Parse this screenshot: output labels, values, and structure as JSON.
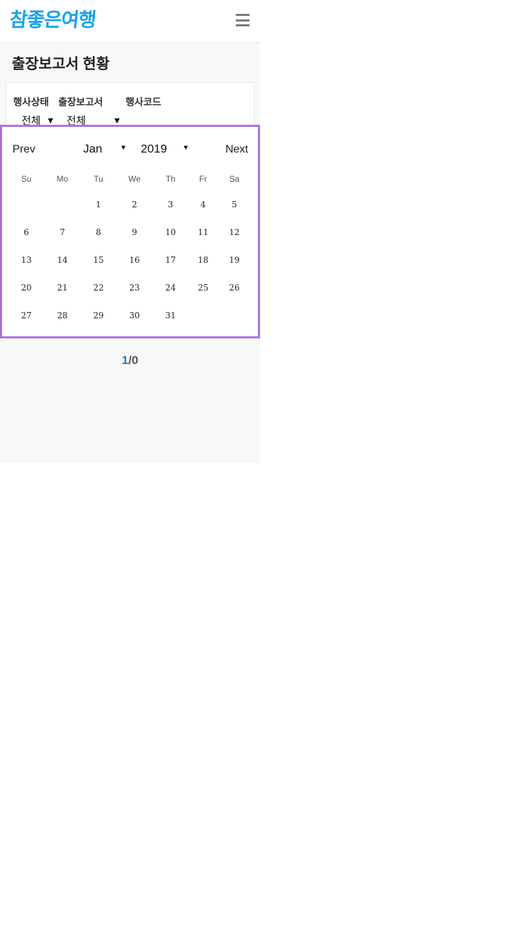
{
  "header": {
    "logo_text": "참좋은여행",
    "menu_icon": "hamburger-menu-icon"
  },
  "page": {
    "title": "출장보고서 현황"
  },
  "filters": {
    "event_status_label": "행사상태",
    "report_label": "출장보고서",
    "event_code_label": "행사코드",
    "event_status_value": "전체",
    "report_value": "전체"
  },
  "calendar": {
    "prev_label": "Prev",
    "next_label": "Next",
    "month_value": "Jan",
    "year_value": "2019",
    "weekdays": [
      "Su",
      "Mo",
      "Tu",
      "We",
      "Th",
      "Fr",
      "Sa"
    ],
    "weeks": [
      [
        "",
        "",
        "1",
        "2",
        "3",
        "4",
        "5"
      ],
      [
        "6",
        "7",
        "8",
        "9",
        "10",
        "11",
        "12"
      ],
      [
        "13",
        "14",
        "15",
        "16",
        "17",
        "18",
        "19"
      ],
      [
        "20",
        "21",
        "22",
        "23",
        "24",
        "25",
        "26"
      ],
      [
        "27",
        "28",
        "29",
        "30",
        "31",
        "",
        ""
      ]
    ],
    "border_color": "#b26fdf"
  },
  "pagination": {
    "current": "1",
    "separator": "/",
    "total": "0"
  }
}
